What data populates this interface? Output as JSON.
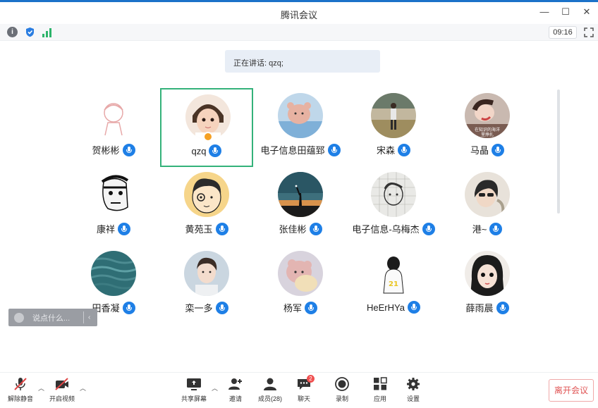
{
  "window": {
    "title": "腾讯会议",
    "timer": "09:16"
  },
  "info_icons": [
    "info-icon",
    "shield-icon",
    "signal-icon"
  ],
  "speaking": {
    "text": "正在讲话: qzq;"
  },
  "participants": [
    {
      "name": "贺彬彬",
      "active": false
    },
    {
      "name": "qzq",
      "active": true,
      "host": true
    },
    {
      "name": "电子信息田蕴郅",
      "active": false
    },
    {
      "name": "宋森",
      "active": false
    },
    {
      "name": "马晶",
      "active": false
    },
    {
      "name": "康祥",
      "active": false
    },
    {
      "name": "黄苑玉",
      "active": false
    },
    {
      "name": "张佳彬",
      "active": false
    },
    {
      "name": "电子信息-乌梅杰",
      "active": false
    },
    {
      "name": "港~",
      "active": false
    },
    {
      "name": "田香凝",
      "active": false
    },
    {
      "name": "栾一多",
      "active": false
    },
    {
      "name": "杨军",
      "active": false
    },
    {
      "name": "HeErHYa",
      "active": false
    },
    {
      "name": "薛雨晨",
      "active": false
    }
  ],
  "chat": {
    "placeholder": "说点什么...",
    "arrow": "‹"
  },
  "toolbar": {
    "mute": "解除静音",
    "video": "开启视频",
    "share": "共享屏幕",
    "invite": "邀请",
    "members": "成员(28)",
    "chat": "聊天",
    "chat_badge": "2",
    "record": "录制",
    "apps": "应用",
    "settings": "设置",
    "leave": "离开会议"
  },
  "colors": {
    "accent": "#1e7fe6",
    "active_border": "#34b27a",
    "leave": "#e05555"
  }
}
